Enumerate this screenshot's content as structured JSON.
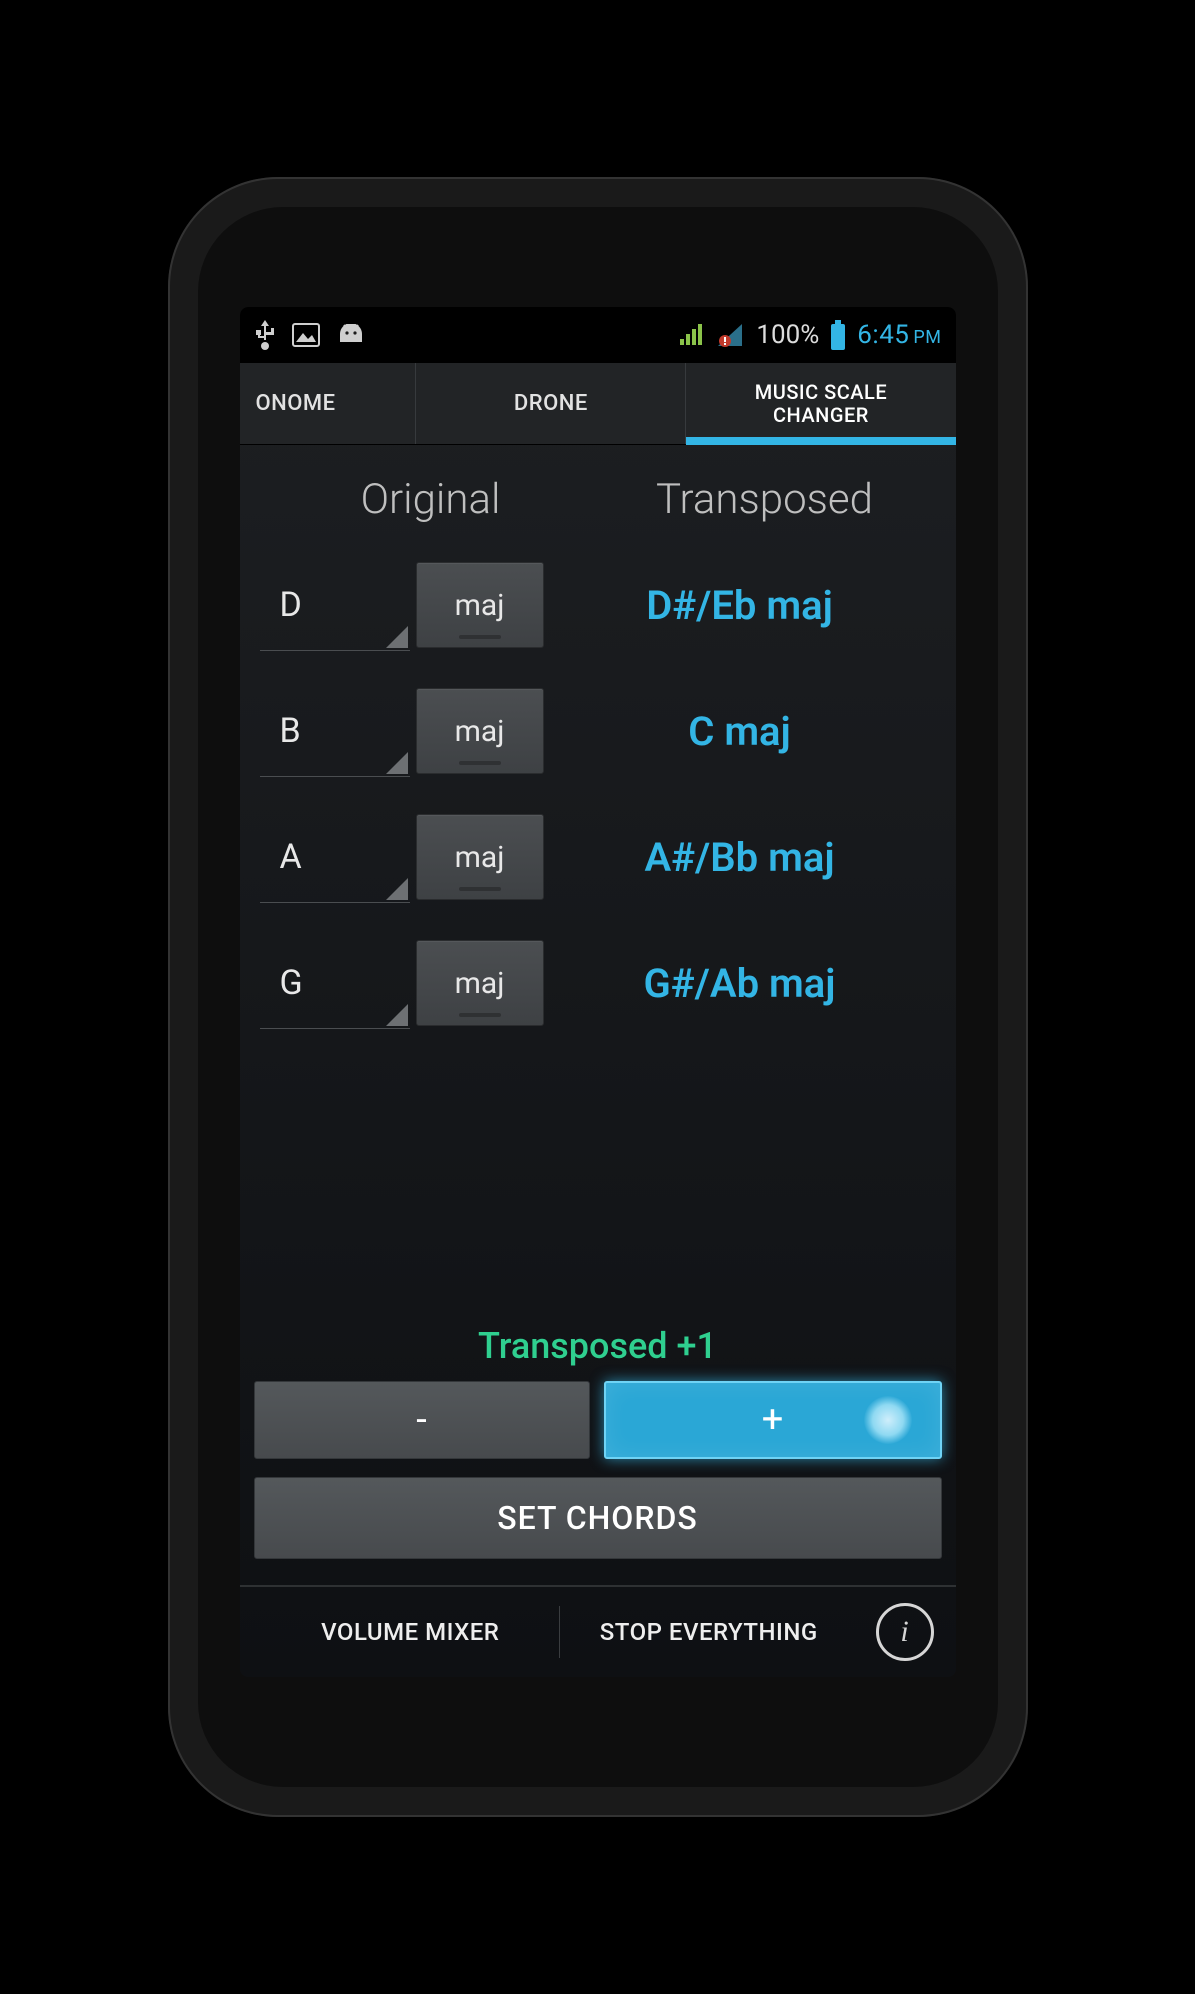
{
  "statusbar": {
    "battery_pct": "100%",
    "time": "6:45",
    "ampm": "PM"
  },
  "tabs": {
    "t0": "ONOME",
    "t1": "DRONE",
    "t2_line1": "MUSIC SCALE",
    "t2_line2": "CHANGER"
  },
  "headers": {
    "original": "Original",
    "transposed": "Transposed"
  },
  "rows": [
    {
      "note": "D",
      "quality": "maj",
      "transposed": "D#/Eb maj"
    },
    {
      "note": "B",
      "quality": "maj",
      "transposed": "C maj"
    },
    {
      "note": "A",
      "quality": "maj",
      "transposed": "A#/Bb maj"
    },
    {
      "note": "G",
      "quality": "maj",
      "transposed": "G#/Ab maj"
    }
  ],
  "transpose": {
    "label": "Transposed +1",
    "minus": "-",
    "plus": "+",
    "amount": 1
  },
  "buttons": {
    "set_chords": "SET CHORDS",
    "volume_mixer": "VOLUME MIXER",
    "stop_everything": "STOP EVERYTHING"
  },
  "colors": {
    "accent": "#33b5e5",
    "success": "#2fcf8f"
  }
}
